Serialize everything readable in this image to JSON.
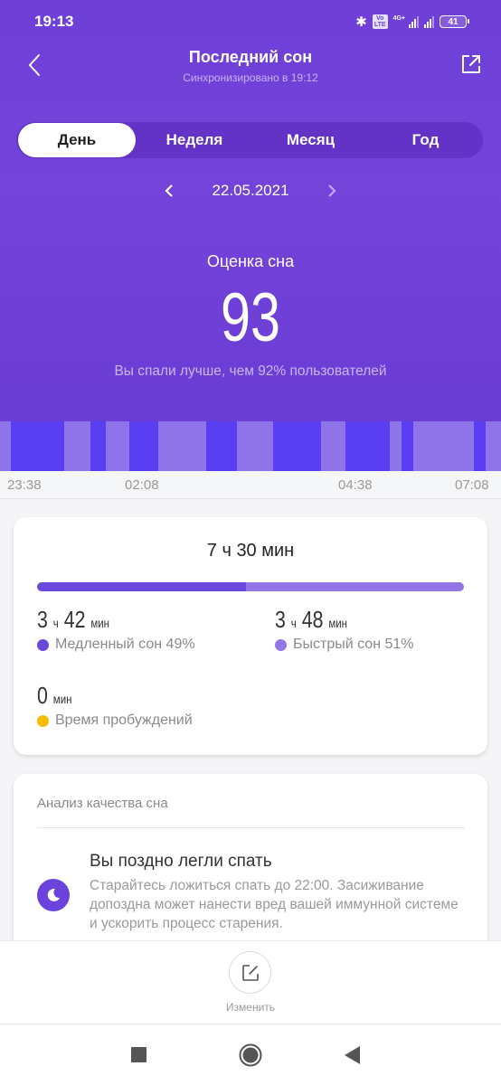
{
  "status_bar": {
    "time": "19:13",
    "network": "4G+",
    "volte": "Vo LTE",
    "battery": "41"
  },
  "header": {
    "title": "Последний сон",
    "subtitle": "Синхронизировано в 19:12",
    "back_icon": "chevron-left-icon",
    "share_icon": "share-export-icon"
  },
  "tabs": [
    {
      "label": "День",
      "active": true
    },
    {
      "label": "Неделя",
      "active": false
    },
    {
      "label": "Месяц",
      "active": false
    },
    {
      "label": "Год",
      "active": false
    }
  ],
  "date_nav": {
    "date": "22.05.2021",
    "prev_icon": "chevron-left-icon",
    "next_icon": "chevron-right-icon"
  },
  "score": {
    "label": "Оценка сна",
    "value": "93",
    "caption": "Вы спали лучше, чем 92% пользователей"
  },
  "colors": {
    "accent": "#6e40d8",
    "deep_sleep": "#5a3ff2",
    "light_sleep": "#8e74e8",
    "awake": "#f5bc00",
    "ratio_deep": "#6b48dc",
    "ratio_light": "#9276e8"
  },
  "hypnogram": {
    "start": "23:38",
    "end": "07:08",
    "total_minutes": 450,
    "time_labels": [
      "23:38",
      "02:08",
      "04:38",
      "07:08"
    ],
    "segments": [
      {
        "stage": "light",
        "from": 0,
        "to": 10
      },
      {
        "stage": "deep",
        "from": 10,
        "to": 58
      },
      {
        "stage": "light",
        "from": 58,
        "to": 81
      },
      {
        "stage": "deep",
        "from": 81,
        "to": 95
      },
      {
        "stage": "light",
        "from": 95,
        "to": 116
      },
      {
        "stage": "deep",
        "from": 116,
        "to": 142
      },
      {
        "stage": "light",
        "from": 142,
        "to": 185
      },
      {
        "stage": "deep",
        "from": 185,
        "to": 213
      },
      {
        "stage": "light",
        "from": 213,
        "to": 245
      },
      {
        "stage": "deep",
        "from": 245,
        "to": 288
      },
      {
        "stage": "light",
        "from": 288,
        "to": 310
      },
      {
        "stage": "deep",
        "from": 310,
        "to": 350
      },
      {
        "stage": "light",
        "from": 350,
        "to": 361
      },
      {
        "stage": "deep",
        "from": 361,
        "to": 371
      },
      {
        "stage": "light",
        "from": 371,
        "to": 426
      },
      {
        "stage": "deep",
        "from": 426,
        "to": 436
      },
      {
        "stage": "light",
        "from": 436,
        "to": 450
      }
    ]
  },
  "summary": {
    "total": "7 ч 30 мин",
    "deep_fraction": 0.49,
    "deep": {
      "hours": "3",
      "h_unit": "ч",
      "minutes": "42",
      "m_unit": "мин",
      "label": "Медленный сон 49%"
    },
    "light": {
      "hours": "3",
      "h_unit": "ч",
      "minutes": "48",
      "m_unit": "мин",
      "label": "Быстрый сон 51%"
    },
    "awake": {
      "minutes": "0",
      "m_unit": "мин",
      "label": "Время пробуждений"
    }
  },
  "analysis": {
    "heading": "Анализ качества сна",
    "tip_icon": "moon-icon",
    "tip_title": "Вы поздно легли спать",
    "tip_body": "Старайтесь ложиться спать до 22:00. Засиживание допоздна может нанести вред вашей иммунной системе и ускорить процесс старения."
  },
  "bottom_action": {
    "icon": "edit-icon",
    "label": "Изменить"
  },
  "nav_bar": {
    "recents_icon": "square-recents-icon",
    "home_icon": "circle-home-icon",
    "back_icon": "triangle-back-icon"
  }
}
